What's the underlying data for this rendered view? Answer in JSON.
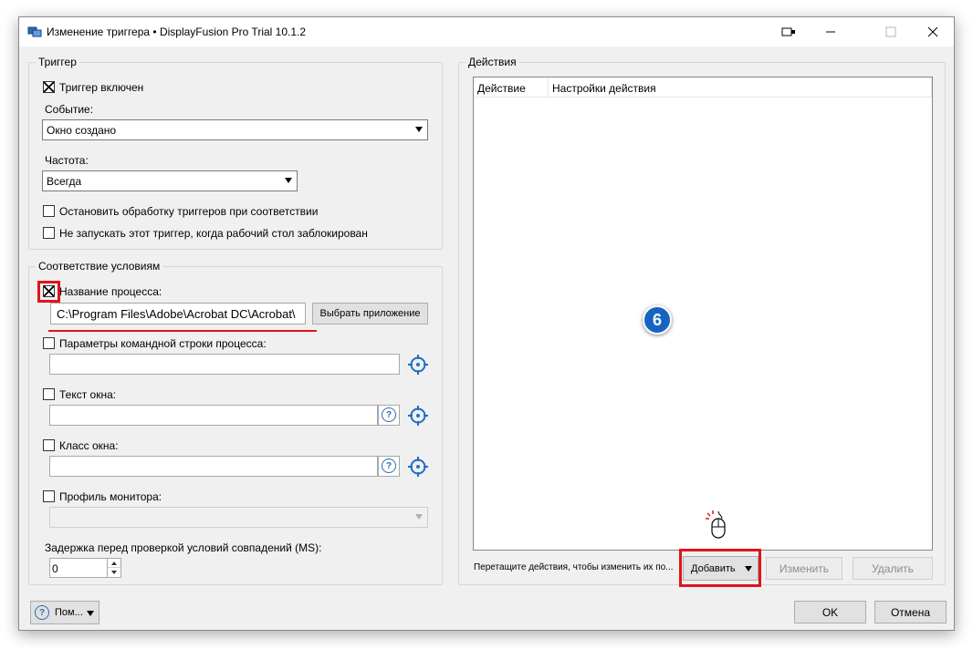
{
  "window": {
    "title": "Изменение триггера • DisplayFusion Pro Trial 10.1.2"
  },
  "trigger_group": {
    "legend": "Триггер",
    "enabled_label": "Триггер включен",
    "enabled_checked": true,
    "event_label": "Событие:",
    "event_value": "Окно создано",
    "frequency_label": "Частота:",
    "frequency_value": "Всегда",
    "stop_processing_label": "Остановить обработку триггеров при соответствии",
    "stop_processing_checked": false,
    "no_run_locked_label": "Не запускать этот триггер, когда рабочий стол заблокирован",
    "no_run_locked_checked": false
  },
  "conditions_group": {
    "legend": "Соответствие условиям",
    "process_name_label": "Название процесса:",
    "process_name_checked": true,
    "process_name_value": "C:\\Program Files\\Adobe\\Acrobat DC\\Acrobat\\",
    "choose_app_button": "Выбрать приложение",
    "cmdline_label": "Параметры командной строки процесса:",
    "cmdline_value": "",
    "window_text_label": "Текст окна:",
    "window_text_value": "",
    "window_class_label": "Класс окна:",
    "window_class_value": "",
    "monitor_profile_label": "Профиль монитора:",
    "monitor_profile_value": "",
    "delay_label": "Задержка перед проверкой условий совпадений (MS):",
    "delay_value": "0"
  },
  "actions_group": {
    "legend": "Действия",
    "columns": [
      "Действие",
      "Настройки действия"
    ],
    "hint": "Перетащите действия, чтобы изменить их по...",
    "add_button": "Добавить",
    "edit_button": "Изменить",
    "delete_button": "Удалить",
    "step_badge": "6"
  },
  "footer": {
    "help_button": "Пом...",
    "ok_button": "OK",
    "cancel_button": "Отмена"
  },
  "colors": {
    "highlight": "#e0141b",
    "badge": "#1565c0",
    "icon_blue": "#1f6fc5"
  },
  "icons": [
    "app-icon",
    "pin-window-icon",
    "minimize-icon",
    "maximize-icon",
    "close-icon",
    "crosshair-icon",
    "help-icon",
    "chevron-down-icon",
    "mouse-click-icon"
  ]
}
